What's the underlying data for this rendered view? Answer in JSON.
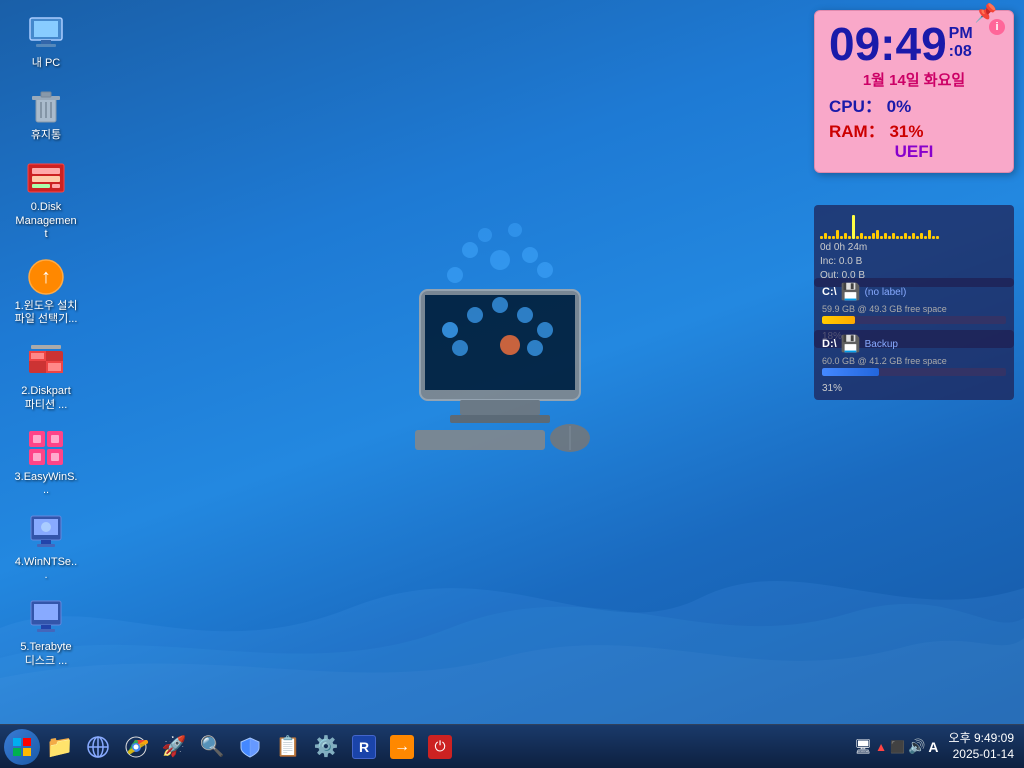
{
  "desktop": {
    "icons": [
      {
        "id": "my-pc",
        "label": "내 PC",
        "emoji": "🖥️",
        "color": "#60aaff"
      },
      {
        "id": "recycle-bin",
        "label": "휴지통",
        "emoji": "🗑️",
        "color": "#ccddff"
      },
      {
        "id": "disk-management",
        "label": "0.Disk\nManagement",
        "emoji": "💿",
        "color": "#ff4444"
      },
      {
        "id": "windows-setup",
        "label": "1.윈도우 설치\n파일 선택기...",
        "emoji": "📀",
        "color": "#ff8800"
      },
      {
        "id": "diskpart",
        "label": "2.Diskpart\n파티션 ...",
        "emoji": "🔧",
        "color": "#ff4444"
      },
      {
        "id": "easywins",
        "label": "3.EasyWinS...",
        "emoji": "🪟",
        "color": "#ff4499"
      },
      {
        "id": "winntse",
        "label": "4.WinNTSe...",
        "emoji": "💻",
        "color": "#88aaff"
      },
      {
        "id": "terabyte",
        "label": "5.Terabyte\n디스크 ...",
        "emoji": "💾",
        "color": "#88aaff"
      }
    ]
  },
  "clock_widget": {
    "time_hour": "09:49",
    "ampm": "PM",
    "seconds": ":08",
    "date": "1월 14일 화요일",
    "cpu_label": "CPU：",
    "cpu_value": "0%",
    "ram_label": "RAM：",
    "ram_value": "31%",
    "uefi": "UEFI"
  },
  "network_widget": {
    "uptime": "0d 0h 24m",
    "inc": "Inc: 0.0 B",
    "out": "Out: 0.0 B",
    "bars": [
      1,
      2,
      1,
      1,
      3,
      1,
      2,
      1,
      8,
      1,
      2,
      1,
      1,
      2,
      3,
      1,
      2,
      1,
      2,
      1,
      1,
      2,
      1,
      2,
      1,
      2,
      1,
      3,
      1,
      1
    ]
  },
  "disk_c": {
    "drive": "C:\\",
    "name": "(no label)",
    "size": "59.9 GB @",
    "free": "49.3 GB free space",
    "percent": 18,
    "percent_label": "18%"
  },
  "disk_d": {
    "drive": "D:\\",
    "name": "Backup",
    "size": "60.0 GB @",
    "free": "41.2 GB free space",
    "percent": 31,
    "percent_label": "31%"
  },
  "taskbar": {
    "start_icon": "⊞",
    "buttons": [
      {
        "id": "folder",
        "emoji": "📁",
        "label": "File Explorer"
      },
      {
        "id": "ie",
        "emoji": "🌐",
        "label": "Internet"
      },
      {
        "id": "chrome",
        "emoji": "🔵",
        "label": "Chrome"
      },
      {
        "id": "rocket",
        "emoji": "🚀",
        "label": "Browser"
      },
      {
        "id": "search",
        "emoji": "🔍",
        "label": "Search"
      },
      {
        "id": "shield",
        "emoji": "🛡️",
        "label": "Security"
      },
      {
        "id": "notes",
        "emoji": "📋",
        "label": "Notes"
      },
      {
        "id": "settings",
        "emoji": "⚙️",
        "label": "Settings"
      },
      {
        "id": "r-app",
        "emoji": "Ⓡ",
        "label": "R App"
      },
      {
        "id": "arrow",
        "emoji": "➡️",
        "label": "Arrow App"
      },
      {
        "id": "power",
        "emoji": "⏻",
        "label": "Power"
      }
    ],
    "tray": {
      "icons": [
        "🖥️",
        "🔺",
        "🔲",
        "🔊",
        "A"
      ],
      "time": "오후 9:49:09",
      "date": "2025-01-14"
    }
  }
}
